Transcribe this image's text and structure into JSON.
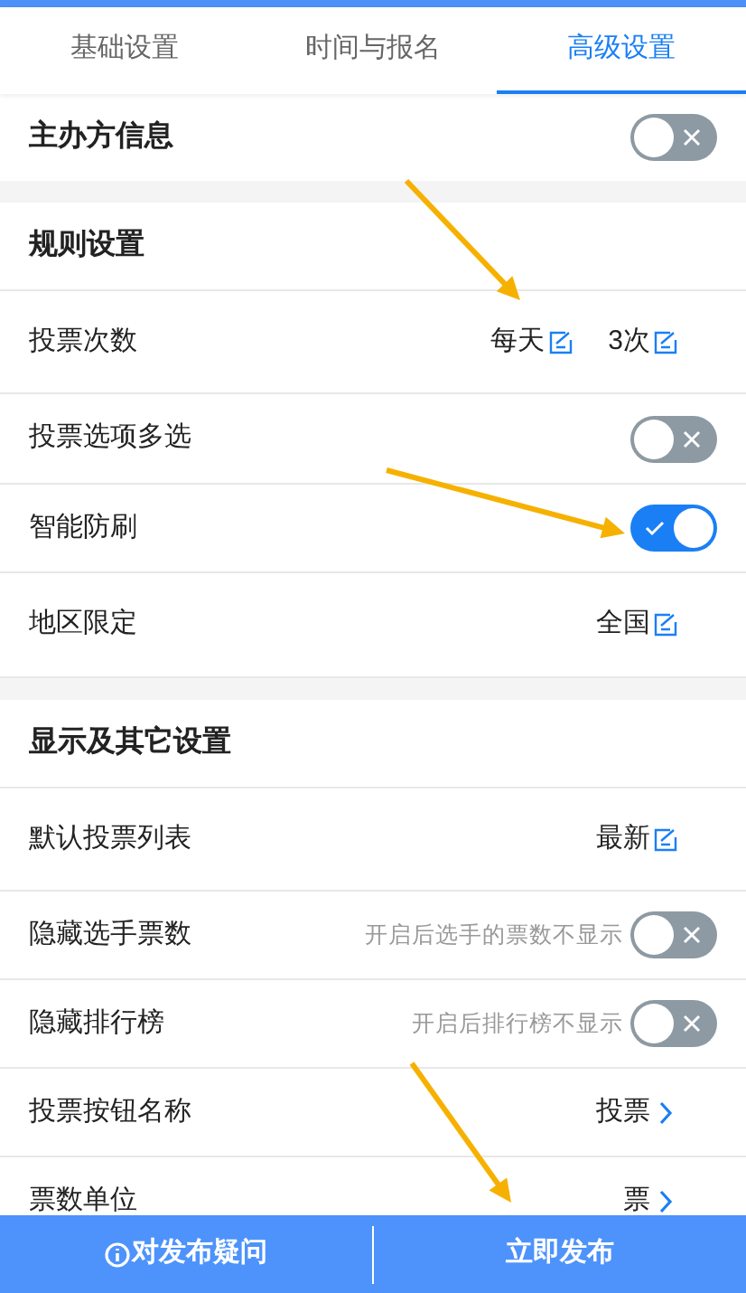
{
  "tabs": [
    {
      "label": "基础设置",
      "selected": false
    },
    {
      "label": "时间与报名",
      "selected": false
    },
    {
      "label": "高级设置",
      "selected": true
    }
  ],
  "organizer": {
    "label": "主办方信息",
    "on": false
  },
  "sections": [
    {
      "title": "规则设置",
      "rows": [
        {
          "kind": "edit",
          "label": "投票次数",
          "values": [
            "每天",
            "3次"
          ]
        },
        {
          "kind": "toggle",
          "label": "投票选项多选",
          "on": false
        },
        {
          "kind": "toggle",
          "label": "智能防刷",
          "on": true
        },
        {
          "kind": "edit",
          "label": "地区限定",
          "values": [
            "全国"
          ]
        }
      ]
    },
    {
      "title": "显示及其它设置",
      "rows": [
        {
          "kind": "edit",
          "label": "默认投票列表",
          "values": [
            "最新"
          ]
        },
        {
          "kind": "toggle",
          "label": "隐藏选手票数",
          "hint": "开启后选手的票数不显示",
          "on": false
        },
        {
          "kind": "toggle",
          "label": "隐藏排行榜",
          "hint": "开启后排行榜不显示",
          "on": false
        },
        {
          "kind": "link",
          "label": "投票按钮名称",
          "value": "投票"
        },
        {
          "kind": "link",
          "label": "票数单位",
          "value": "票"
        }
      ]
    }
  ],
  "footer": {
    "help": "对发布疑问",
    "publish": "立即发布"
  }
}
